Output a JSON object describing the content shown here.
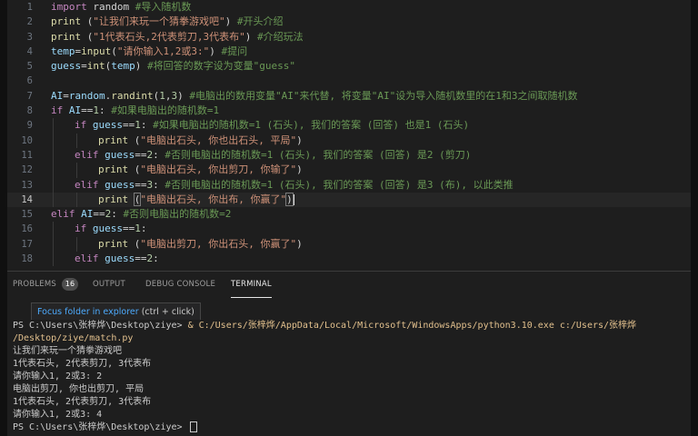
{
  "editor": {
    "active_line": 14,
    "lines": [
      {
        "n": 1,
        "indent": 0,
        "tokens": [
          [
            "kw",
            "import"
          ],
          [
            "pl",
            " random "
          ],
          [
            "cm",
            "#导入随机数"
          ]
        ]
      },
      {
        "n": 2,
        "indent": 0,
        "tokens": [
          [
            "fn",
            "print"
          ],
          [
            "pl",
            " ("
          ],
          [
            "str",
            "\"让我们来玩一个猜拳游戏吧\""
          ],
          [
            "pl",
            ") "
          ],
          [
            "cm",
            "#开头介绍"
          ]
        ]
      },
      {
        "n": 3,
        "indent": 0,
        "tokens": [
          [
            "fn",
            "print"
          ],
          [
            "pl",
            " ("
          ],
          [
            "str",
            "\"1代表石头,2代表剪刀,3代表布\""
          ],
          [
            "pl",
            ") "
          ],
          [
            "cm",
            "#介绍玩法"
          ]
        ]
      },
      {
        "n": 4,
        "indent": 0,
        "tokens": [
          [
            "var",
            "temp"
          ],
          [
            "pl",
            "="
          ],
          [
            "fn",
            "input"
          ],
          [
            "pl",
            "("
          ],
          [
            "str",
            "\"请你输入1,2或3:\""
          ],
          [
            "pl",
            ") "
          ],
          [
            "cm",
            "#提问"
          ]
        ]
      },
      {
        "n": 5,
        "indent": 0,
        "tokens": [
          [
            "var",
            "guess"
          ],
          [
            "pl",
            "="
          ],
          [
            "fn",
            "int"
          ],
          [
            "pl",
            "("
          ],
          [
            "var",
            "temp"
          ],
          [
            "pl",
            ") "
          ],
          [
            "cm",
            "#将回答的数字设为变量\"guess\""
          ]
        ]
      },
      {
        "n": 6,
        "indent": 0,
        "tokens": []
      },
      {
        "n": 7,
        "indent": 0,
        "tokens": [
          [
            "var",
            "AI"
          ],
          [
            "pl",
            "="
          ],
          [
            "var",
            "random"
          ],
          [
            "pl",
            "."
          ],
          [
            "fn",
            "randint"
          ],
          [
            "pl",
            "("
          ],
          [
            "num",
            "1"
          ],
          [
            "pl",
            ","
          ],
          [
            "num",
            "3"
          ],
          [
            "pl",
            ") "
          ],
          [
            "cm",
            "#电脑出的数用变量\"AI\"来代替, 将变量\"AI\"设为导入随机数里的在1和3之间取随机数"
          ]
        ]
      },
      {
        "n": 8,
        "indent": 0,
        "tokens": [
          [
            "kw",
            "if"
          ],
          [
            "pl",
            " "
          ],
          [
            "var",
            "AI"
          ],
          [
            "pl",
            "=="
          ],
          [
            "num",
            "1"
          ],
          [
            "pl",
            ": "
          ],
          [
            "cm",
            "#如果电脑出的随机数=1"
          ]
        ]
      },
      {
        "n": 9,
        "indent": 1,
        "tokens": [
          [
            "kw",
            "if"
          ],
          [
            "pl",
            " "
          ],
          [
            "var",
            "guess"
          ],
          [
            "pl",
            "=="
          ],
          [
            "num",
            "1"
          ],
          [
            "pl",
            ": "
          ],
          [
            "cm",
            "#如果电脑出的随机数=1 (石头), 我们的答案 (回答) 也是1 (石头)"
          ]
        ]
      },
      {
        "n": 10,
        "indent": 2,
        "tokens": [
          [
            "fn",
            "print"
          ],
          [
            "pl",
            " ("
          ],
          [
            "str",
            "\"电脑出石头, 你也出石头, 平局\""
          ],
          [
            "pl",
            ")"
          ]
        ]
      },
      {
        "n": 11,
        "indent": 1,
        "tokens": [
          [
            "kw",
            "elif"
          ],
          [
            "pl",
            " "
          ],
          [
            "var",
            "guess"
          ],
          [
            "pl",
            "=="
          ],
          [
            "num",
            "2"
          ],
          [
            "pl",
            ": "
          ],
          [
            "cm",
            "#否则电脑出的随机数=1 (石头), 我们的答案 (回答) 是2 (剪刀)"
          ]
        ]
      },
      {
        "n": 12,
        "indent": 2,
        "tokens": [
          [
            "fn",
            "print"
          ],
          [
            "pl",
            " ("
          ],
          [
            "str",
            "\"电脑出石头, 你出剪刀, 你输了\""
          ],
          [
            "pl",
            ")"
          ]
        ]
      },
      {
        "n": 13,
        "indent": 1,
        "tokens": [
          [
            "kw",
            "elif"
          ],
          [
            "pl",
            " "
          ],
          [
            "var",
            "guess"
          ],
          [
            "pl",
            "=="
          ],
          [
            "num",
            "3"
          ],
          [
            "pl",
            ": "
          ],
          [
            "cm",
            "#否则电脑出的随机数=1 (石头), 我们的答案 (回答) 是3 (布), 以此类推"
          ]
        ]
      },
      {
        "n": 14,
        "indent": 2,
        "tokens": [
          [
            "fn",
            "print"
          ],
          [
            "pl",
            " "
          ],
          [
            "box",
            "("
          ],
          [
            "str",
            "\"电脑出石头, 你出布, 你赢了\""
          ],
          [
            "box",
            ")"
          ]
        ]
      },
      {
        "n": 15,
        "indent": 0,
        "tokens": [
          [
            "kw",
            "elif"
          ],
          [
            "pl",
            " "
          ],
          [
            "var",
            "AI"
          ],
          [
            "pl",
            "=="
          ],
          [
            "num",
            "2"
          ],
          [
            "pl",
            ": "
          ],
          [
            "cm",
            "#否则电脑出的随机数=2"
          ]
        ]
      },
      {
        "n": 16,
        "indent": 1,
        "tokens": [
          [
            "kw",
            "if"
          ],
          [
            "pl",
            " "
          ],
          [
            "var",
            "guess"
          ],
          [
            "pl",
            "=="
          ],
          [
            "num",
            "1"
          ],
          [
            "pl",
            ":"
          ]
        ]
      },
      {
        "n": 17,
        "indent": 2,
        "tokens": [
          [
            "fn",
            "print"
          ],
          [
            "pl",
            " ("
          ],
          [
            "str",
            "\"电脑出剪刀, 你出石头, 你赢了\""
          ],
          [
            "pl",
            ")"
          ]
        ]
      },
      {
        "n": 18,
        "indent": 1,
        "tokens": [
          [
            "kw",
            "elif"
          ],
          [
            "pl",
            " "
          ],
          [
            "var",
            "guess"
          ],
          [
            "pl",
            "=="
          ],
          [
            "num",
            "2"
          ],
          [
            "pl",
            ":"
          ]
        ]
      }
    ]
  },
  "panel": {
    "tabs": [
      {
        "label": "PROBLEMS",
        "badge": "16",
        "active": false
      },
      {
        "label": "OUTPUT",
        "badge": "",
        "active": false
      },
      {
        "label": "DEBUG CONSOLE",
        "badge": "",
        "active": false
      },
      {
        "label": "TERMINAL",
        "badge": "",
        "active": true
      }
    ],
    "tooltip": {
      "link_text": "Focus folder in explorer",
      "shortcut": " (ctrl + click)"
    }
  },
  "terminal": {
    "lines": [
      {
        "prompt": "PS C:\\Users\\张梓烨\\Desktop\\ziye> ",
        "text": "& C:/Users/张梓烨/AppData/Local/Microsoft/WindowsApps/python3.10.exe c:/Users/张梓烨"
      },
      {
        "prompt": "",
        "text": "/Desktop/ziye/match.py"
      },
      {
        "prompt": "",
        "text": "让我们来玩一个猜拳游戏吧"
      },
      {
        "prompt": "",
        "text": "1代表石头, 2代表剪刀, 3代表布"
      },
      {
        "prompt": "",
        "text": "请你输入1, 2或3: 2"
      },
      {
        "prompt": "",
        "text": "电脑出剪刀, 你也出剪刀, 平局"
      },
      {
        "prompt": "",
        "text": "1代表石头, 2代表剪刀, 3代表布"
      },
      {
        "prompt": "",
        "text": "请你输入1, 2或3: 4"
      },
      {
        "prompt": "PS C:\\Users\\张梓烨\\Desktop\\ziye> ",
        "text": ""
      }
    ]
  },
  "colors": {
    "editor_bg": "#1e1e1e",
    "keyword": "#c586c0",
    "function": "#dcdcaa",
    "string": "#ce9178",
    "comment": "#6a9955",
    "number": "#b5cea8",
    "variable": "#9cdcfe",
    "tooltip_link": "#4daafc"
  }
}
